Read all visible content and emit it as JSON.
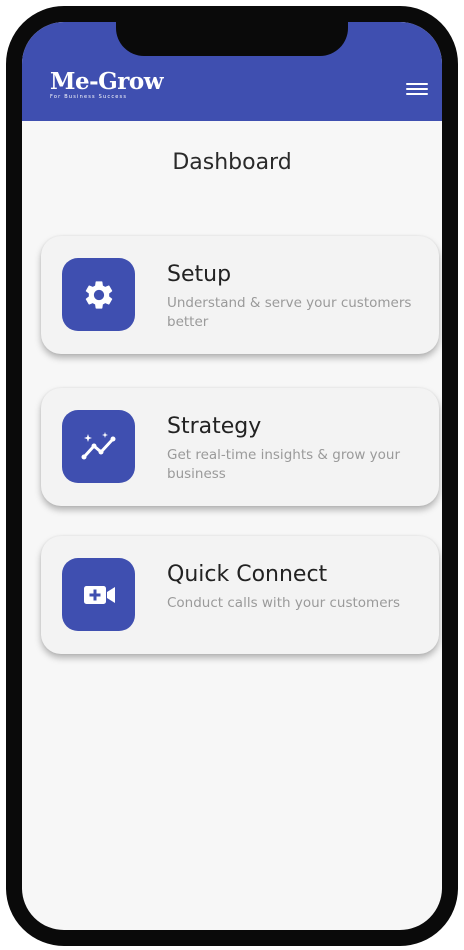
{
  "app": {
    "brand_name": "Me-Grow",
    "brand_tagline": "For Business Success"
  },
  "page": {
    "title": "Dashboard"
  },
  "cards": [
    {
      "title": "Setup",
      "description": "Understand & serve your customers better",
      "icon": "gear-icon"
    },
    {
      "title": "Strategy",
      "description": "Get real-time insights & grow your business",
      "icon": "sparkle-trend-icon"
    },
    {
      "title": "Quick Connect",
      "description": "Conduct calls with your customers",
      "icon": "video-call-icon"
    }
  ],
  "colors": {
    "brand": "#3f4fb0",
    "background": "#f7f7f7",
    "card": "#f3f3f3",
    "title_text": "#222222",
    "description_text": "#9a9a9a"
  }
}
